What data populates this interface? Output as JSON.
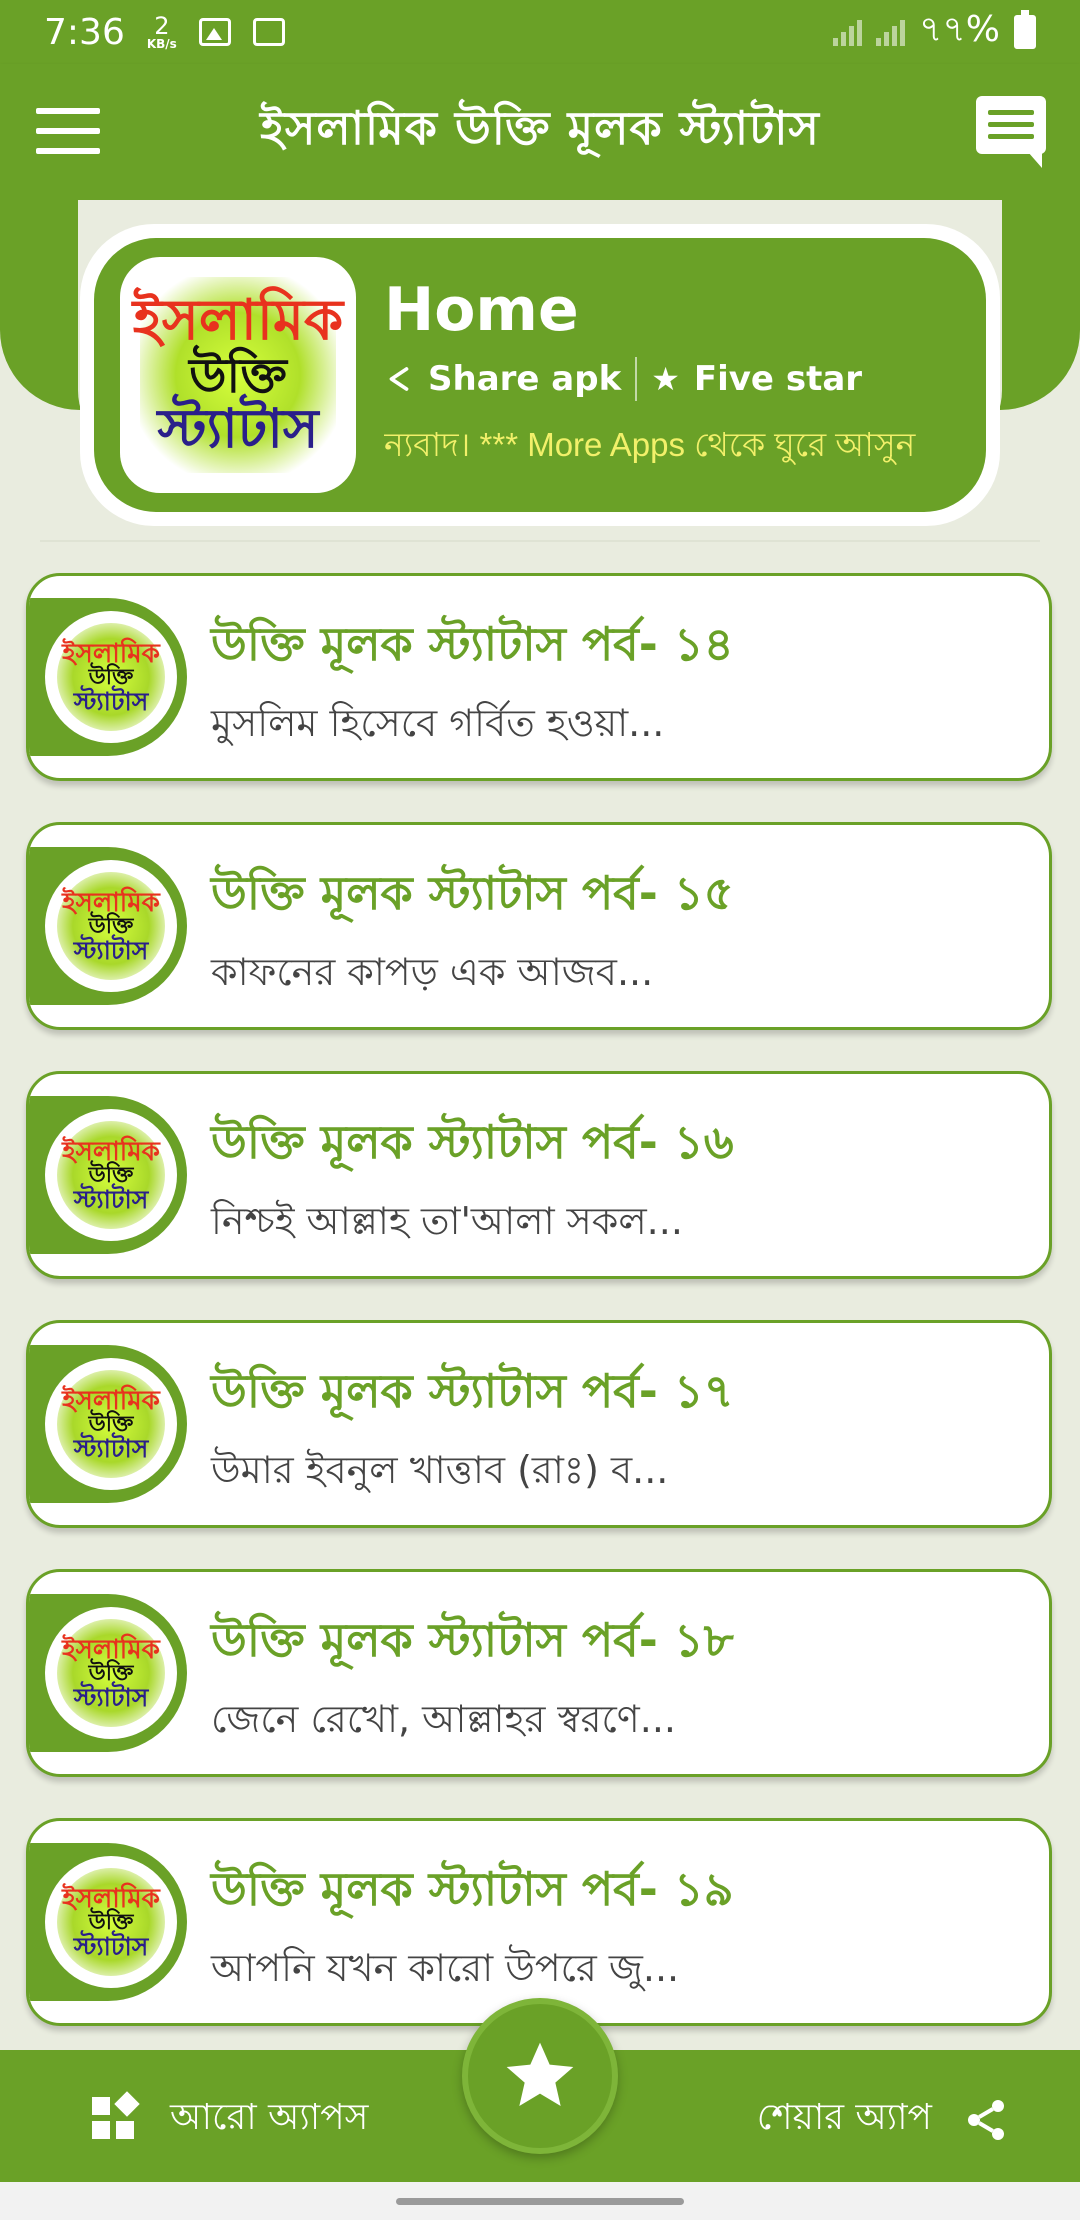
{
  "status_bar": {
    "time": "7:36",
    "net_speed_value": "2",
    "net_speed_unit": "KB/s",
    "battery": "৭৭%"
  },
  "app_bar": {
    "title": "ইসলামিক উক্তি মূলক স্ট্যাটাস",
    "menu_icon": "hamburger-menu-icon",
    "message_icon": "message-icon"
  },
  "header": {
    "logo_text": [
      "ইসলামিক",
      "উক্তি",
      "স্ট্যাটাস"
    ],
    "title": "Home",
    "share_label": "Share apk",
    "rate_label": "Five star",
    "marquee": "ন্যবাদ। *** More Apps থেকে ঘুরে আসুন"
  },
  "items": [
    {
      "title": "উক্তি মূলক স্ট্যাটাস পর্ব- ১৪",
      "subtitle": "মুসলিম হিসেবে গর্বিত হওয়া..."
    },
    {
      "title": "উক্তি মূলক স্ট্যাটাস পর্ব- ১৫",
      "subtitle": "কাফনের কাপড় এক আজব..."
    },
    {
      "title": "উক্তি মূলক স্ট্যাটাস পর্ব- ১৬",
      "subtitle": "নিশ্চই আল্লাহ তা'আলা সকল..."
    },
    {
      "title": "উক্তি মূলক স্ট্যাটাস পর্ব- ১৭",
      "subtitle": "উমার ইবনুল খাত্তাব (রাঃ) ব..."
    },
    {
      "title": "উক্তি মূলক স্ট্যাটাস পর্ব- ১৮",
      "subtitle": "জেনে রেখো, আল্লাহর স্বরণে..."
    },
    {
      "title": "উক্তি মূলক স্ট্যাটাস পর্ব- ১৯",
      "subtitle": "আপনি যখন কারো উপরে জু..."
    }
  ],
  "bottom_bar": {
    "more_apps_label": "আরো অ্যাপস",
    "share_app_label": "শেয়ার অ্যাপ"
  },
  "colors": {
    "primary": "#6aa127",
    "accent_text": "#f2f06a",
    "background": "#e9ecdf"
  }
}
